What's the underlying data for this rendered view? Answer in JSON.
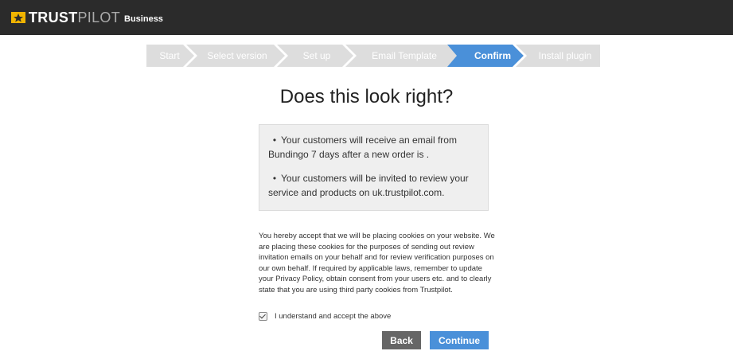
{
  "header": {
    "brand_part1": "TRUST",
    "brand_part2": "PILOT",
    "brand_suffix": "Business",
    "brand_accent_color": "#f0b400"
  },
  "wizard": {
    "steps": [
      {
        "label": "Start",
        "state": "done"
      },
      {
        "label": "Select version",
        "state": "done"
      },
      {
        "label": "Set up",
        "state": "done"
      },
      {
        "label": "Email Template",
        "state": "done"
      },
      {
        "label": "Confirm",
        "state": "active"
      },
      {
        "label": "Install plugin",
        "state": "todo"
      }
    ],
    "inactive_color": "#dddddd",
    "active_color": "#4a90d9"
  },
  "main": {
    "title": "Does this look right?",
    "summary": [
      "Your customers will receive an email from Bundingo 7 days after a new order is .",
      "Your customers will be invited to review your service and products on uk.trustpilot.com."
    ],
    "legal_text": "You hereby accept that we will be placing cookies on your website. We are placing these cookies for the purposes of sending out review invitation emails on your behalf and for review verification purposes on our own behalf. If required by applicable laws, remember to update your Privacy Policy, obtain consent from your users etc. and to clearly state that you are using third party cookies from Trustpilot.",
    "accept_label": "I understand and accept the above",
    "accept_checked": true
  },
  "actions": {
    "back_label": "Back",
    "continue_label": "Continue"
  }
}
